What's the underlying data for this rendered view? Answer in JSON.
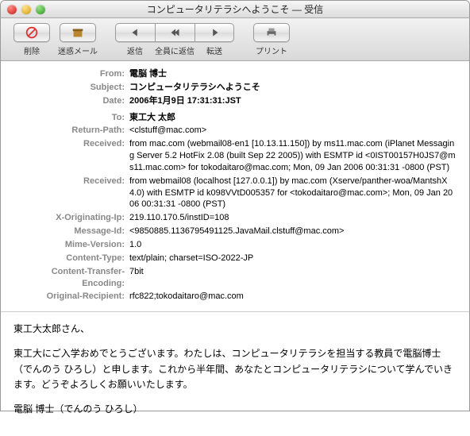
{
  "window": {
    "title": "コンピュータリテラシへようこそ — 受信"
  },
  "toolbar": {
    "delete": "削除",
    "junk": "迷惑メール",
    "reply": "返信",
    "reply_all": "全員に返信",
    "forward": "転送",
    "print": "プリント"
  },
  "labels": {
    "from": "From:",
    "subject": "Subject:",
    "date": "Date:",
    "to": "To:",
    "return_path": "Return-Path:",
    "received": "Received:",
    "x_orig_ip": "X-Originating-Ip:",
    "message_id": "Message-Id:",
    "mime": "Mime-Version:",
    "content_type": "Content-Type:",
    "cte": "Content-Transfer-Encoding:",
    "orig_recip": "Original-Recipient:"
  },
  "headers": {
    "from": "電脳 博士",
    "subject": "コンピュータリテラシへようこそ",
    "date": "2006年1月9日 17:31:31:JST",
    "to": "東工大 太郎",
    "return_path": "<clstuff@mac.com>",
    "received1": "from mac.com (webmail08-en1 [10.13.11.150]) by ms11.mac.com (iPlanet Messaging Server 5.2 HotFix 2.08 (built Sep 22 2005)) with ESMTP id <0IST00157H0JS7@ms11.mac.com> for tokodaitaro@mac.com; Mon, 09 Jan 2006 00:31:31 -0800 (PST)",
    "received2": "from webmail08 (localhost [127.0.0.1]) by mac.com (Xserve/panther-woa/MantshX 4.0) with ESMTP id k098VVtD005357 for <tokodaitaro@mac.com>; Mon, 09 Jan 2006 00:31:31 -0800 (PST)",
    "x_orig_ip": "219.110.170.5/instID=108",
    "message_id": "<9850885.1136795491125.JavaMail.clstuff@mac.com>",
    "mime": "1.0",
    "content_type": "text/plain; charset=ISO-2022-JP",
    "cte": "7bit",
    "orig_recip": "rfc822;tokodaitaro@mac.com"
  },
  "body": {
    "p1": "東工大太郎さん、",
    "p2": "東工大にご入学おめでとうございます。わたしは、コンピュータリテラシを担当する教員で電脳博士（でんのう ひろし）と申します。これから半年間、あなたとコンピュータリテラシについて学んでいきます。どうぞよろしくお願いいたします。",
    "p3": "電脳 博士（でんのう ひろし）"
  }
}
